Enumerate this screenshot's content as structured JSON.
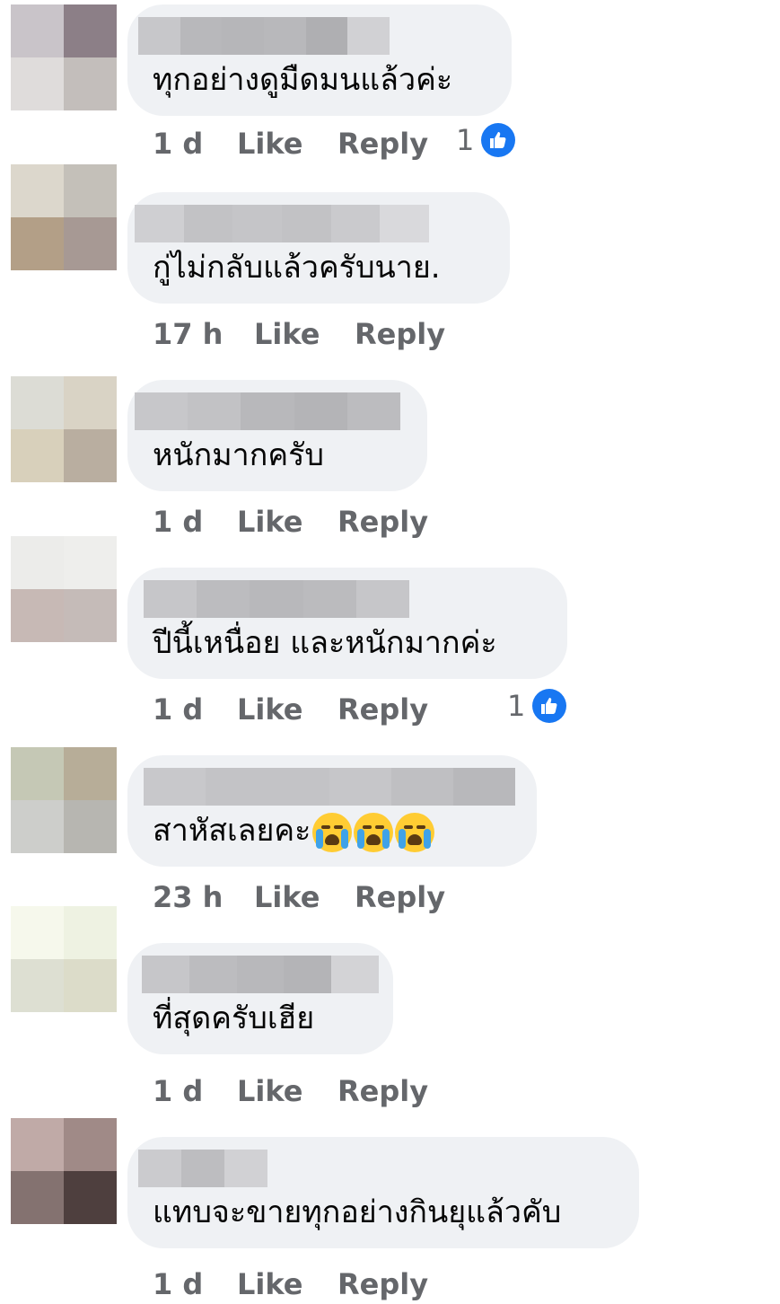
{
  "comments": [
    {
      "text": "ทุกอย่างดูมืดมนแล้วค่ะ",
      "time": "1 d",
      "like": "Like",
      "reply": "Reply",
      "reaction_count": "1",
      "reaction_icon": "like-icon",
      "avatar_colors": [
        "#c9c4c9",
        "#8c7f87",
        "#dfdcdb",
        "#c3bebb"
      ],
      "name_bar_colors": [
        "#c7c7ca",
        "#b8b8bb",
        "#b6b6b9",
        "#b8b8bb",
        "#afafb2",
        "#d1d1d4"
      ]
    },
    {
      "text": "กู่ไม่กลับแล้วครับนาย.",
      "time": "17 h",
      "like": "Like",
      "reply": "Reply",
      "reaction_count": "",
      "reaction_icon": "",
      "avatar_colors": [
        "#dcd7cc",
        "#c4c0b9",
        "#b39f87",
        "#a79994"
      ],
      "name_bar_colors": [
        "#cfcfd2",
        "#c2c2c5",
        "#c5c5c8",
        "#c2c2c5",
        "#cacacd",
        "#d9d9dc"
      ]
    },
    {
      "text": "หนักมากครับ",
      "time": "1 d",
      "like": "Like",
      "reply": "Reply",
      "reaction_count": "",
      "reaction_icon": "",
      "avatar_colors": [
        "#dcdcd5",
        "#d9d3c5",
        "#d8d0bb",
        "#b9aea0"
      ],
      "name_bar_colors": [
        "#c7c7ca",
        "#c2c2c5",
        "#b8b8bb",
        "#b4b4b7",
        "#bcbcbf"
      ]
    },
    {
      "text": "ปีนี้เหนื่อย และหนักมากค่ะ",
      "time": "1 d",
      "like": "Like",
      "reply": "Reply",
      "reaction_count": "1",
      "reaction_icon": "like-icon",
      "avatar_colors": [
        "#ececea",
        "#eeeeec",
        "#c7b9b5",
        "#c5bbb8"
      ],
      "name_bar_colors": [
        "#c6c6c9",
        "#bcbcbf",
        "#b8b8bb",
        "#bbbbbe",
        "#c6c6c9"
      ]
    },
    {
      "text": "สาหัสเลยคะ",
      "emojis": [
        "crying-face-emoji",
        "crying-face-emoji",
        "crying-face-emoji"
      ],
      "time": "23 h",
      "like": "Like",
      "reply": "Reply",
      "reaction_count": "",
      "reaction_icon": "",
      "avatar_colors": [
        "#c5c8b5",
        "#b7ad98",
        "#cdcecb",
        "#b7b6b1"
      ],
      "name_bar_colors": [
        "#c8c8cb",
        "#c3c3c6",
        "#c3c3c6",
        "#c6c6c9",
        "#bfbfc2",
        "#b8b8bb"
      ]
    },
    {
      "text": "ที่สุดครับเฮีย",
      "time": "1 d",
      "like": "Like",
      "reply": "Reply",
      "reaction_count": "",
      "reaction_icon": "",
      "avatar_colors": [
        "#f6f8ec",
        "#eef2e2",
        "#dddfd2",
        "#dcdcc9"
      ],
      "name_bar_colors": [
        "#c6c6c9",
        "#bcbcbf",
        "#b8b8bb",
        "#b4b4b7",
        "#d3d3d6"
      ]
    },
    {
      "text": "แทบจะขายทุกอย่างกินยุแล้วคับ",
      "time": "1 d",
      "like": "Like",
      "reply": "Reply",
      "reaction_count": "",
      "reaction_icon": "",
      "avatar_colors": [
        "#c0aaa7",
        "#a08a87",
        "#847270",
        "#4e3f3e"
      ],
      "name_bar_colors": [
        "#cbcbce",
        "#bdbdc0",
        "#d1d1d4"
      ]
    }
  ]
}
